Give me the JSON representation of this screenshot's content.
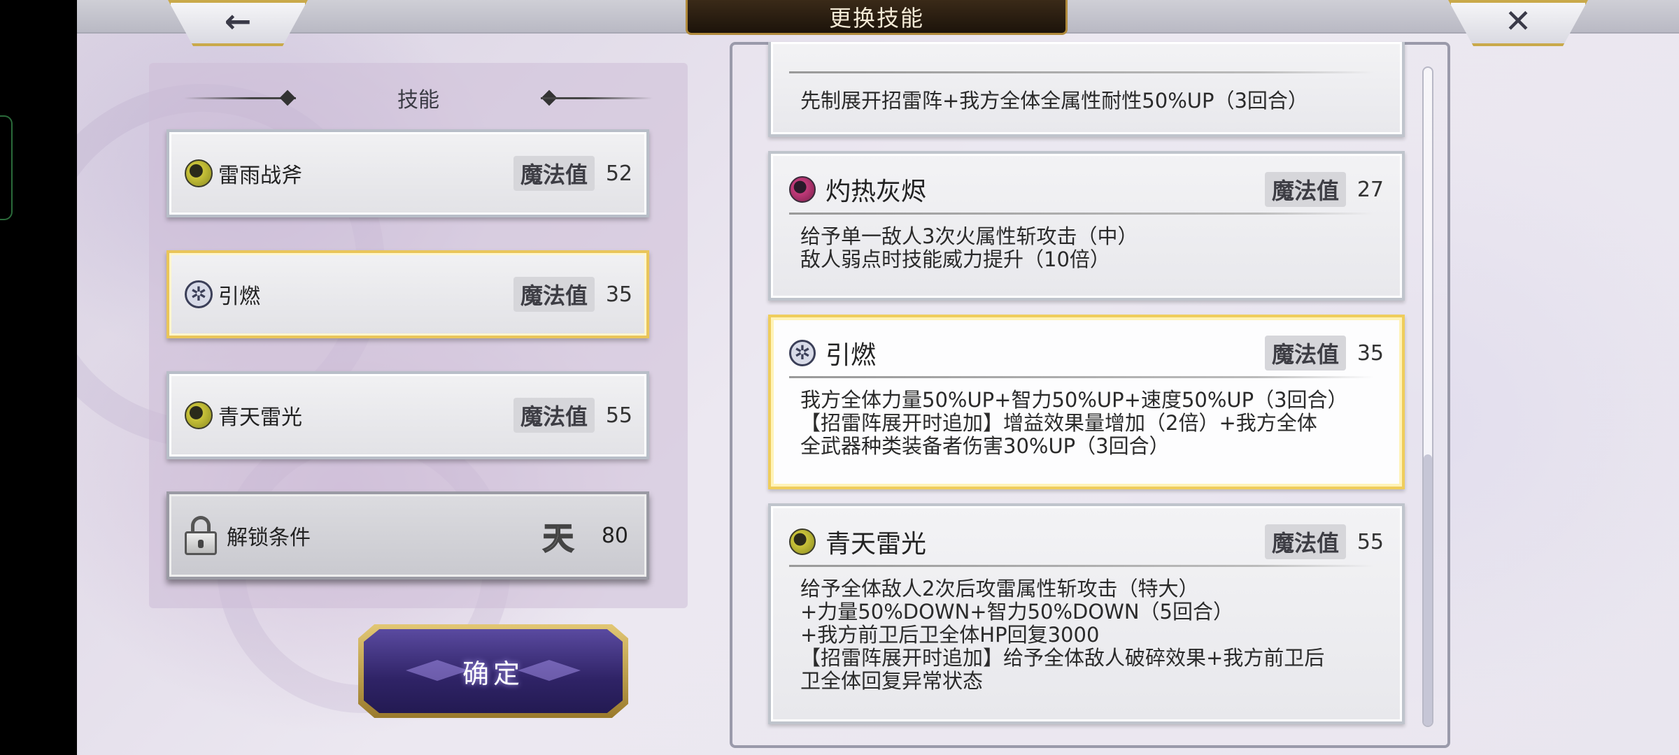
{
  "header": {
    "title": "更换技能",
    "back_glyph": "←",
    "close_glyph": "✕"
  },
  "skill_panel": {
    "title": "技能",
    "mp_label": "魔法值",
    "slots": [
      {
        "name": "雷雨战斧",
        "mp": "52",
        "icon": "thunder-orb-icon"
      },
      {
        "name": "引燃",
        "mp": "35",
        "icon": "ignite-gear-icon",
        "selected": true
      },
      {
        "name": "青天雷光",
        "mp": "55",
        "icon": "thunder-orb-icon"
      }
    ],
    "locked_slot": {
      "label": "解锁条件",
      "glyph": "天",
      "value": "80"
    }
  },
  "confirm_label": "确定",
  "detail_panel": {
    "mp_label": "魔法值",
    "cards": [
      {
        "desc": "先制展开招雷阵+我方全体全属性耐性50%UP（3回合）"
      },
      {
        "name": "灼热灰烬",
        "mp": "27",
        "icon": "fire-orb-icon",
        "desc": "给予单一敌人3次火属性斩攻击（中）\n敌人弱点时技能威力提升（10倍）"
      },
      {
        "name": "引燃",
        "mp": "35",
        "icon": "ignite-gear-icon",
        "selected": true,
        "desc": "我方全体力量50%UP+智力50%UP+速度50%UP（3回合）\n【招雷阵展开时追加】增益效果量增加（2倍）+我方全体\n全武器种类装备者伤害30%UP（3回合）"
      },
      {
        "name": "青天雷光",
        "mp": "55",
        "icon": "thunder-orb-icon",
        "desc": "给予全体敌人2次后攻雷属性斩攻击（特大）\n+力量50%DOWN+智力50%DOWN（5回合）\n+我方前卫后卫全体HP回复3000\n【招雷阵展开时追加】给予全体敌人破碎效果+我方前卫后\n卫全体回复异常状态"
      }
    ]
  },
  "colors": {
    "selected_border": "#efcd5c",
    "confirm_button": "#2f2366",
    "title_banner": "#1c130a"
  }
}
